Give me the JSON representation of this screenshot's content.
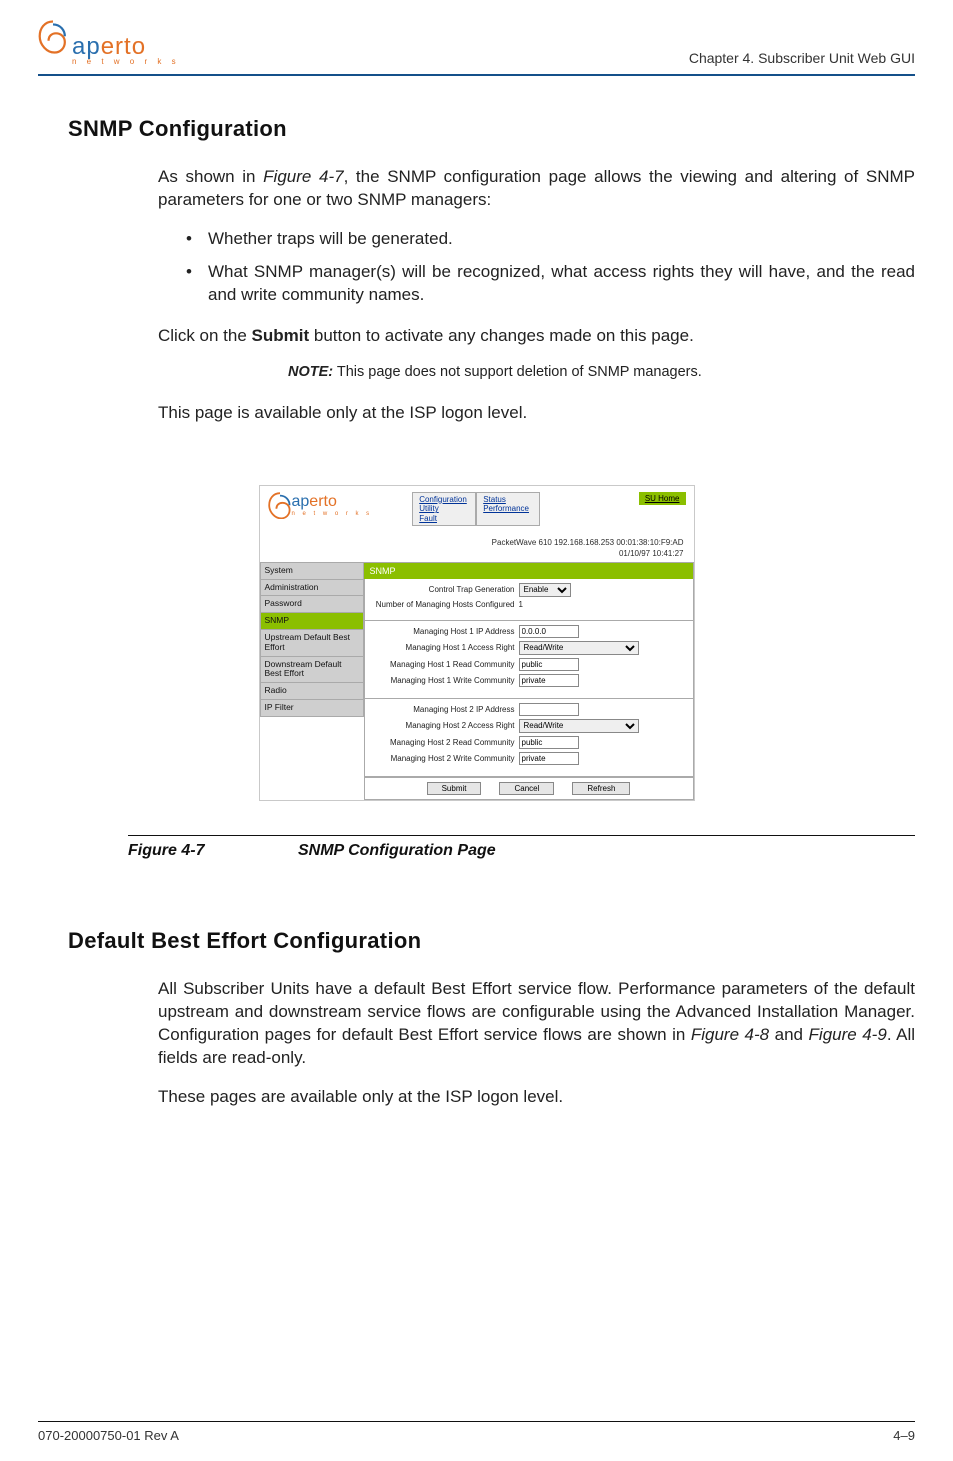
{
  "header": {
    "logo_blue": "ap",
    "logo_orange": "erto",
    "logo_sub": "n e t w o r k s",
    "chapter": "Chapter 4.  Subscriber Unit Web GUI"
  },
  "section1": {
    "title": "SNMP Configuration",
    "intro_a": "As shown in ",
    "intro_link": "Figure 4-7",
    "intro_b": ", the SNMP configuration page allows the viewing and altering of SNMP parameters for one or two SNMP managers:",
    "bullets": [
      "Whether traps will be generated.",
      "What SNMP manager(s) will be recognized, what access rights they will have, and the read and write community names."
    ],
    "submit_a": "Click on the ",
    "submit_bold": "Submit",
    "submit_b": " button to activate any changes made on this page.",
    "note_label": "NOTE:",
    "note_text": "  This page does not support deletion of SNMP managers.",
    "avail": "This page is available only at the ISP logon level."
  },
  "figure": {
    "tabs_left": {
      "l1": "Configuration",
      "l2": "Utility",
      "l3": "Fault"
    },
    "tabs_right": {
      "l1": "Status",
      "l2": "Performance"
    },
    "su_home": "SU Home",
    "status_line1": "PacketWave 610    192.168.168.253    00:01:38:10:F9:AD",
    "status_line2": "01/10/97    10:41:27",
    "sidebar": [
      "System",
      "Administration",
      "Password",
      "SNMP",
      "Upstream Default Best Effort",
      "Downstream Default Best Effort",
      "Radio",
      "IP Filter"
    ],
    "panel_title": "SNMP",
    "fields": {
      "ctrl_trap_lbl": "Control Trap Generation",
      "ctrl_trap_val": "Enable",
      "num_hosts_lbl": "Number of Managing Hosts Configured",
      "num_hosts_val": "1",
      "h1_ip_lbl": "Managing Host 1 IP Address",
      "h1_ip_val": "0.0.0.0",
      "h1_acc_lbl": "Managing Host 1 Access Right",
      "h1_acc_val": "Read/Write",
      "h1_rc_lbl": "Managing Host 1 Read Community",
      "h1_rc_val": "public",
      "h1_wc_lbl": "Managing Host 1 Write Community",
      "h1_wc_val": "private",
      "h2_ip_lbl": "Managing Host 2 IP Address",
      "h2_ip_val": "",
      "h2_acc_lbl": "Managing Host 2 Access Right",
      "h2_acc_val": "Read/Write",
      "h2_rc_lbl": "Managing Host 2 Read Community",
      "h2_rc_val": "public",
      "h2_wc_lbl": "Managing Host 2 Write Community",
      "h2_wc_val": "private"
    },
    "buttons": {
      "submit": "Submit",
      "cancel": "Cancel",
      "refresh": "Refresh"
    },
    "caption_num": "Figure 4-7",
    "caption_text": "SNMP Configuration Page"
  },
  "section2": {
    "title": "Default Best Effort Configuration",
    "p1_a": "All Subscriber Units have a default Best Effort service flow. Performance parameters of the default upstream and downstream service flows are configurable using the Advanced Installation Manager. Configuration pages for default Best Effort service flows are shown in ",
    "p1_link1": "Figure 4-8",
    "p1_mid": " and ",
    "p1_link2": "Figure 4-9",
    "p1_b": ". All fields are read-only.",
    "p2": "These pages are available only at the ISP logon level."
  },
  "footer": {
    "left": "070-20000750-01 Rev A",
    "right": "4–9"
  }
}
